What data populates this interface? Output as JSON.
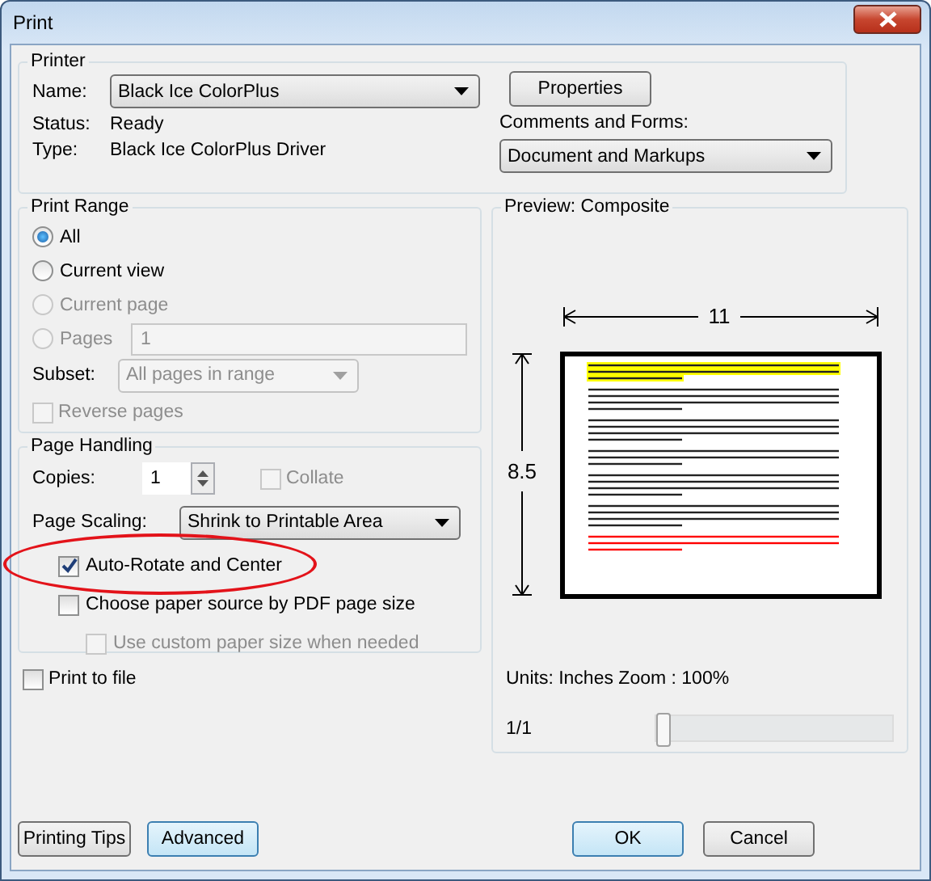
{
  "window": {
    "title": "Print"
  },
  "printer": {
    "legend": "Printer",
    "name_label": "Name:",
    "name_value": "Black Ice ColorPlus",
    "status_label": "Status:",
    "status_value": "Ready",
    "type_label": "Type:",
    "type_value": "Black Ice ColorPlus Driver",
    "properties_button": "Properties",
    "comments_label": "Comments and Forms:",
    "comments_value": "Document and Markups"
  },
  "print_range": {
    "legend": "Print Range",
    "options": [
      {
        "label": "All",
        "selected": true,
        "disabled": false
      },
      {
        "label": "Current view",
        "selected": false,
        "disabled": false
      },
      {
        "label": "Current page",
        "selected": false,
        "disabled": true
      },
      {
        "label": "Pages",
        "selected": false,
        "disabled": true
      }
    ],
    "pages_value": "1",
    "subset_label": "Subset:",
    "subset_value": "All pages in range",
    "subset_disabled": true,
    "reverse": {
      "label": "Reverse pages",
      "checked": false,
      "disabled": true
    }
  },
  "page_handling": {
    "legend": "Page Handling",
    "copies_label": "Copies:",
    "copies_value": "1",
    "collate": {
      "label": "Collate",
      "checked": false,
      "disabled": true
    },
    "scaling_label": "Page Scaling:",
    "scaling_value": "Shrink to Printable Area",
    "options": [
      {
        "label": "Auto-Rotate and Center",
        "checked": true,
        "disabled": false,
        "highlighted": true
      },
      {
        "label": "Choose paper source by PDF page size",
        "checked": false,
        "disabled": false,
        "children": [
          {
            "label": "Use custom paper size when needed",
            "checked": false,
            "disabled": true
          }
        ]
      }
    ]
  },
  "print_to_file": {
    "label": "Print to file",
    "checked": false,
    "disabled": false
  },
  "preview": {
    "legend": "Preview: Composite",
    "width_label": "11",
    "height_label": "8.5",
    "units": "Units: Inches Zoom : 100%",
    "page": "1/1",
    "slider": {
      "level": 0
    }
  },
  "left_buttons": [
    {
      "label": "Printing Tips",
      "default": false
    },
    {
      "label": "Advanced",
      "default": true
    }
  ],
  "dialog_buttons": [
    {
      "label": "OK",
      "default": true
    },
    {
      "label": "Cancel",
      "default": false
    }
  ]
}
